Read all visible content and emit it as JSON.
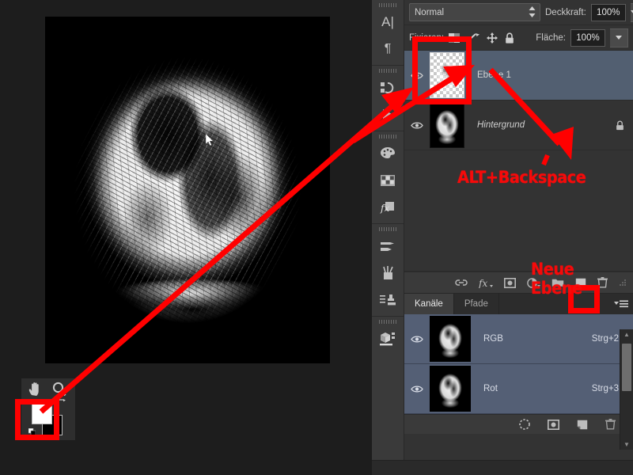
{
  "app": {
    "name": "photoshop-tutorial-screenshot",
    "document_title": "ice-cube-cat"
  },
  "colors": {
    "panel_bg": "#333333",
    "rail_bg": "#3a3a3a",
    "layer_selected": "#525f71",
    "channel_row": "#545f75",
    "annotation_red": "#ff0000",
    "annotation_text_red": "#f60a0a",
    "canvas_bg": "#1d1d1d",
    "foreground_swatch": "#ffffff",
    "background_swatch": "#000000"
  },
  "canvas": {
    "name": "document-canvas",
    "image_description": "High-contrast black and white ice cube with a cat silhouette frozen inside, plus reflection",
    "cursor": "move-tool-cursor"
  },
  "tool_footer": {
    "hand_tool": "hand-tool",
    "zoom_tool": "zoom-tool",
    "foreground_color": "#ffffff",
    "background_color": "#000000",
    "swap_colors": "swap-colors-icon",
    "default_colors": "default-colors-icon"
  },
  "tool_rail": {
    "items": [
      {
        "icon": "text-tool-icon",
        "glyph": "A|"
      },
      {
        "icon": "paragraph-icon",
        "glyph": "¶"
      },
      {
        "icon": "history-icon",
        "glyph": ""
      },
      {
        "icon": "actions-play-icon",
        "glyph": "▶"
      },
      {
        "icon": "color-palette-icon",
        "glyph": ""
      },
      {
        "icon": "swatches-grid-icon",
        "glyph": ""
      },
      {
        "icon": "fx-styles-icon",
        "glyph": "fx"
      },
      {
        "icon": "brush-preset-icon",
        "glyph": ""
      },
      {
        "icon": "brush-tips-icon",
        "glyph": ""
      },
      {
        "icon": "clone-source-icon",
        "glyph": ""
      },
      {
        "icon": "3d-panel-icon",
        "glyph": ""
      }
    ]
  },
  "layers_panel": {
    "blend_mode": {
      "label": "Normal",
      "control": "blend-mode-select"
    },
    "opacity": {
      "label": "Deckkraft:",
      "value": "100%"
    },
    "lock_row": {
      "label": "Fixieren:",
      "icons": [
        "lock-transparency-icon",
        "lock-image-icon",
        "lock-position-icon",
        "lock-all-icon"
      ]
    },
    "fill": {
      "label": "Fläche:",
      "value": "100%"
    },
    "layers": [
      {
        "name": "Ebene 1",
        "selected": true,
        "visible": true,
        "locked": false,
        "italic": false,
        "thumb": "transparent-checker-thumbnail"
      },
      {
        "name": "Hintergrund",
        "selected": false,
        "visible": true,
        "locked": true,
        "italic": true,
        "thumb": "ice-cube-thumbnail"
      }
    ],
    "toolbar_icons": [
      "link-layers-icon",
      "layer-styles-fx-icon",
      "add-layer-mask-icon",
      "new-adjustment-layer-icon",
      "new-group-icon",
      "new-layer-icon",
      "delete-layer-icon"
    ]
  },
  "channels_panel": {
    "tabs": [
      {
        "label": "Kanäle",
        "active": true
      },
      {
        "label": "Pfade",
        "active": false
      }
    ],
    "panel_menu": "panel-menu-icon",
    "channels": [
      {
        "name": "RGB",
        "shortcut": "Strg+2",
        "visible": true
      },
      {
        "name": "Rot",
        "shortcut": "Strg+3",
        "visible": true
      }
    ],
    "toolbar_icons": [
      "load-channel-as-selection-icon",
      "save-selection-as-channel-icon",
      "new-channel-icon",
      "delete-channel-icon"
    ]
  },
  "annotations": {
    "texts": [
      {
        "id": "alt-backspace",
        "text": "ALT+Backspace"
      },
      {
        "id": "neue-ebene",
        "text": "Neue Ebene"
      }
    ],
    "boxes": [
      {
        "id": "layer-thumbnail-highlight"
      },
      {
        "id": "new-layer-button-highlight"
      },
      {
        "id": "color-swatch-highlight"
      }
    ],
    "arrows": [
      {
        "id": "arrow-to-layer-thumbnail-from-swatch"
      },
      {
        "id": "arrow-to-layer-thumbnail-left"
      },
      {
        "id": "arrow-down-to-new-layer"
      },
      {
        "id": "arrow-up-to-alt-backspace"
      }
    ]
  }
}
